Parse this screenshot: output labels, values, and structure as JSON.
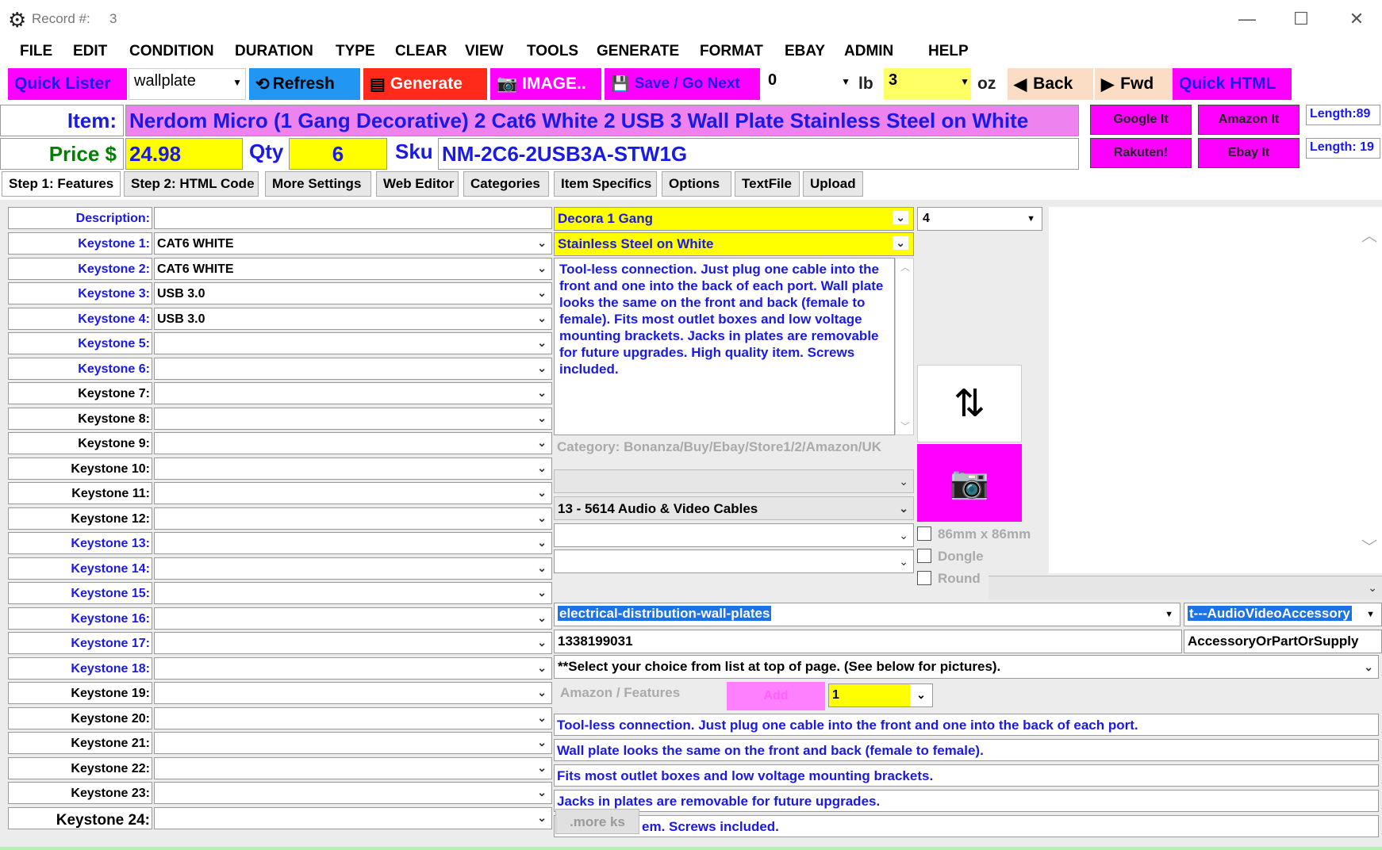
{
  "window": {
    "title_label": "Record #:",
    "record_number": "3"
  },
  "menu": [
    "FILE",
    "EDIT",
    "CONDITION",
    "DURATION",
    "TYPE",
    "CLEAR",
    "VIEW",
    "TOOLS",
    "GENERATE",
    "FORMAT",
    "EBAY",
    "ADMIN",
    "HELP"
  ],
  "toolbar": {
    "quick_lister": "Quick Lister",
    "template_value": "wallplate",
    "refresh": "Refresh",
    "generate": "Generate",
    "image": "IMAGE..",
    "save_next": "Save / Go Next",
    "lb_value": "0",
    "lb_label": "lb",
    "oz_value": "3",
    "oz_label": "oz",
    "back": "Back",
    "fwd": "Fwd",
    "quick_html": "Quick HTML"
  },
  "item": {
    "item_label": "Item:",
    "title": "Nerdom Micro (1 Gang Decorative) 2 Cat6 White 2 USB 3 Wall Plate Stainless Steel on White",
    "price_label": "Price $",
    "price": "24.98",
    "qty_label": "Qty",
    "qty": "6",
    "sku_label": "Sku",
    "sku": "NM-2C6-2USB3A-STW1G",
    "google": "Google It",
    "amazon": "Amazon It",
    "rakuten": "Rakuten!",
    "ebay": "Ebay It",
    "length_title": "Length:89",
    "length_sku": "Length: 19"
  },
  "tabs": [
    "Step 1: Features",
    "Step 2: HTML Code",
    "More Settings",
    "Web Editor",
    "Categories",
    "Item Specifics",
    "Options",
    "TextFile",
    "Upload"
  ],
  "features": {
    "description_label": "Description:",
    "rows": [
      {
        "label": "Keystone 1:",
        "value": "CAT6 WHITE"
      },
      {
        "label": "Keystone 2:",
        "value": "CAT6 WHITE"
      },
      {
        "label": "Keystone 3:",
        "value": "USB 3.0"
      },
      {
        "label": "Keystone 4:",
        "value": "USB 3.0"
      },
      {
        "label": "Keystone 5:",
        "value": ""
      },
      {
        "label": "Keystone 6:",
        "value": ""
      },
      {
        "label": "Keystone 7:",
        "value": ""
      },
      {
        "label": "Keystone 8:",
        "value": ""
      },
      {
        "label": "Keystone 9:",
        "value": ""
      },
      {
        "label": "Keystone 10:",
        "value": ""
      },
      {
        "label": "Keystone 11:",
        "value": ""
      },
      {
        "label": "Keystone 12:",
        "value": ""
      },
      {
        "label": "Keystone 13:",
        "value": ""
      },
      {
        "label": "Keystone 14:",
        "value": ""
      },
      {
        "label": "Keystone 15:",
        "value": ""
      },
      {
        "label": "Keystone 16:",
        "value": ""
      },
      {
        "label": "Keystone 17:",
        "value": ""
      },
      {
        "label": "Keystone 18:",
        "value": ""
      },
      {
        "label": "Keystone 19:",
        "value": ""
      },
      {
        "label": "Keystone 20:",
        "value": ""
      },
      {
        "label": "Keystone 21:",
        "value": ""
      },
      {
        "label": "Keystone 22:",
        "value": ""
      },
      {
        "label": "Keystone 23:",
        "value": ""
      },
      {
        "label": "Keystone 24:",
        "value": ""
      }
    ]
  },
  "right": {
    "plate_type": "Decora 1 Gang",
    "ports_count": "4",
    "color": "Stainless Steel on White",
    "description_text": "Tool-less connection. Just plug one cable into the front and one into the back of each port. Wall plate looks the same on the front and back (female to female). Fits most outlet boxes and low voltage mounting brackets. Jacks in plates are removable for future upgrades. High quality item. Screws included.",
    "category_hint": "Category: Bonanza/Buy/Ebay/Store1/2/Amazon/UK",
    "category_2": "13 - 5614 Audio & Video Cables",
    "check_86mm": "86mm x 86mm",
    "check_dongle": "Dongle",
    "check_round": "Round",
    "amazon_category": "electrical-distribution-wall-plates",
    "amazon_type": "t---AudioVideoAccessory",
    "node_id": "1338199031",
    "product_type": "AccessoryOrPartOrSupply",
    "select_hint": "**Select your choice from list at top of page. (See below for pictures).",
    "amazon_features_label": "Amazon / Features",
    "add_label": "Add",
    "feature_index": "1",
    "feature_lines": [
      "Tool-less connection. Just plug one cable into the front and one into the back of each port.",
      "Wall plate looks the same on the front and back (female to female).",
      "Fits most outlet boxes and low voltage mounting brackets.",
      "Jacks in plates are removable for future upgrades.",
      "em. Screws included."
    ],
    "more_ks": ".more ks"
  },
  "colors": {
    "magenta": "#ff00ff",
    "yellow": "#ffff00",
    "red": "#ff2a1a",
    "blue_link": "#1a1ae6",
    "peach": "#fbdcc4",
    "sky": "#2196f3",
    "pink": "#ee82ee"
  }
}
